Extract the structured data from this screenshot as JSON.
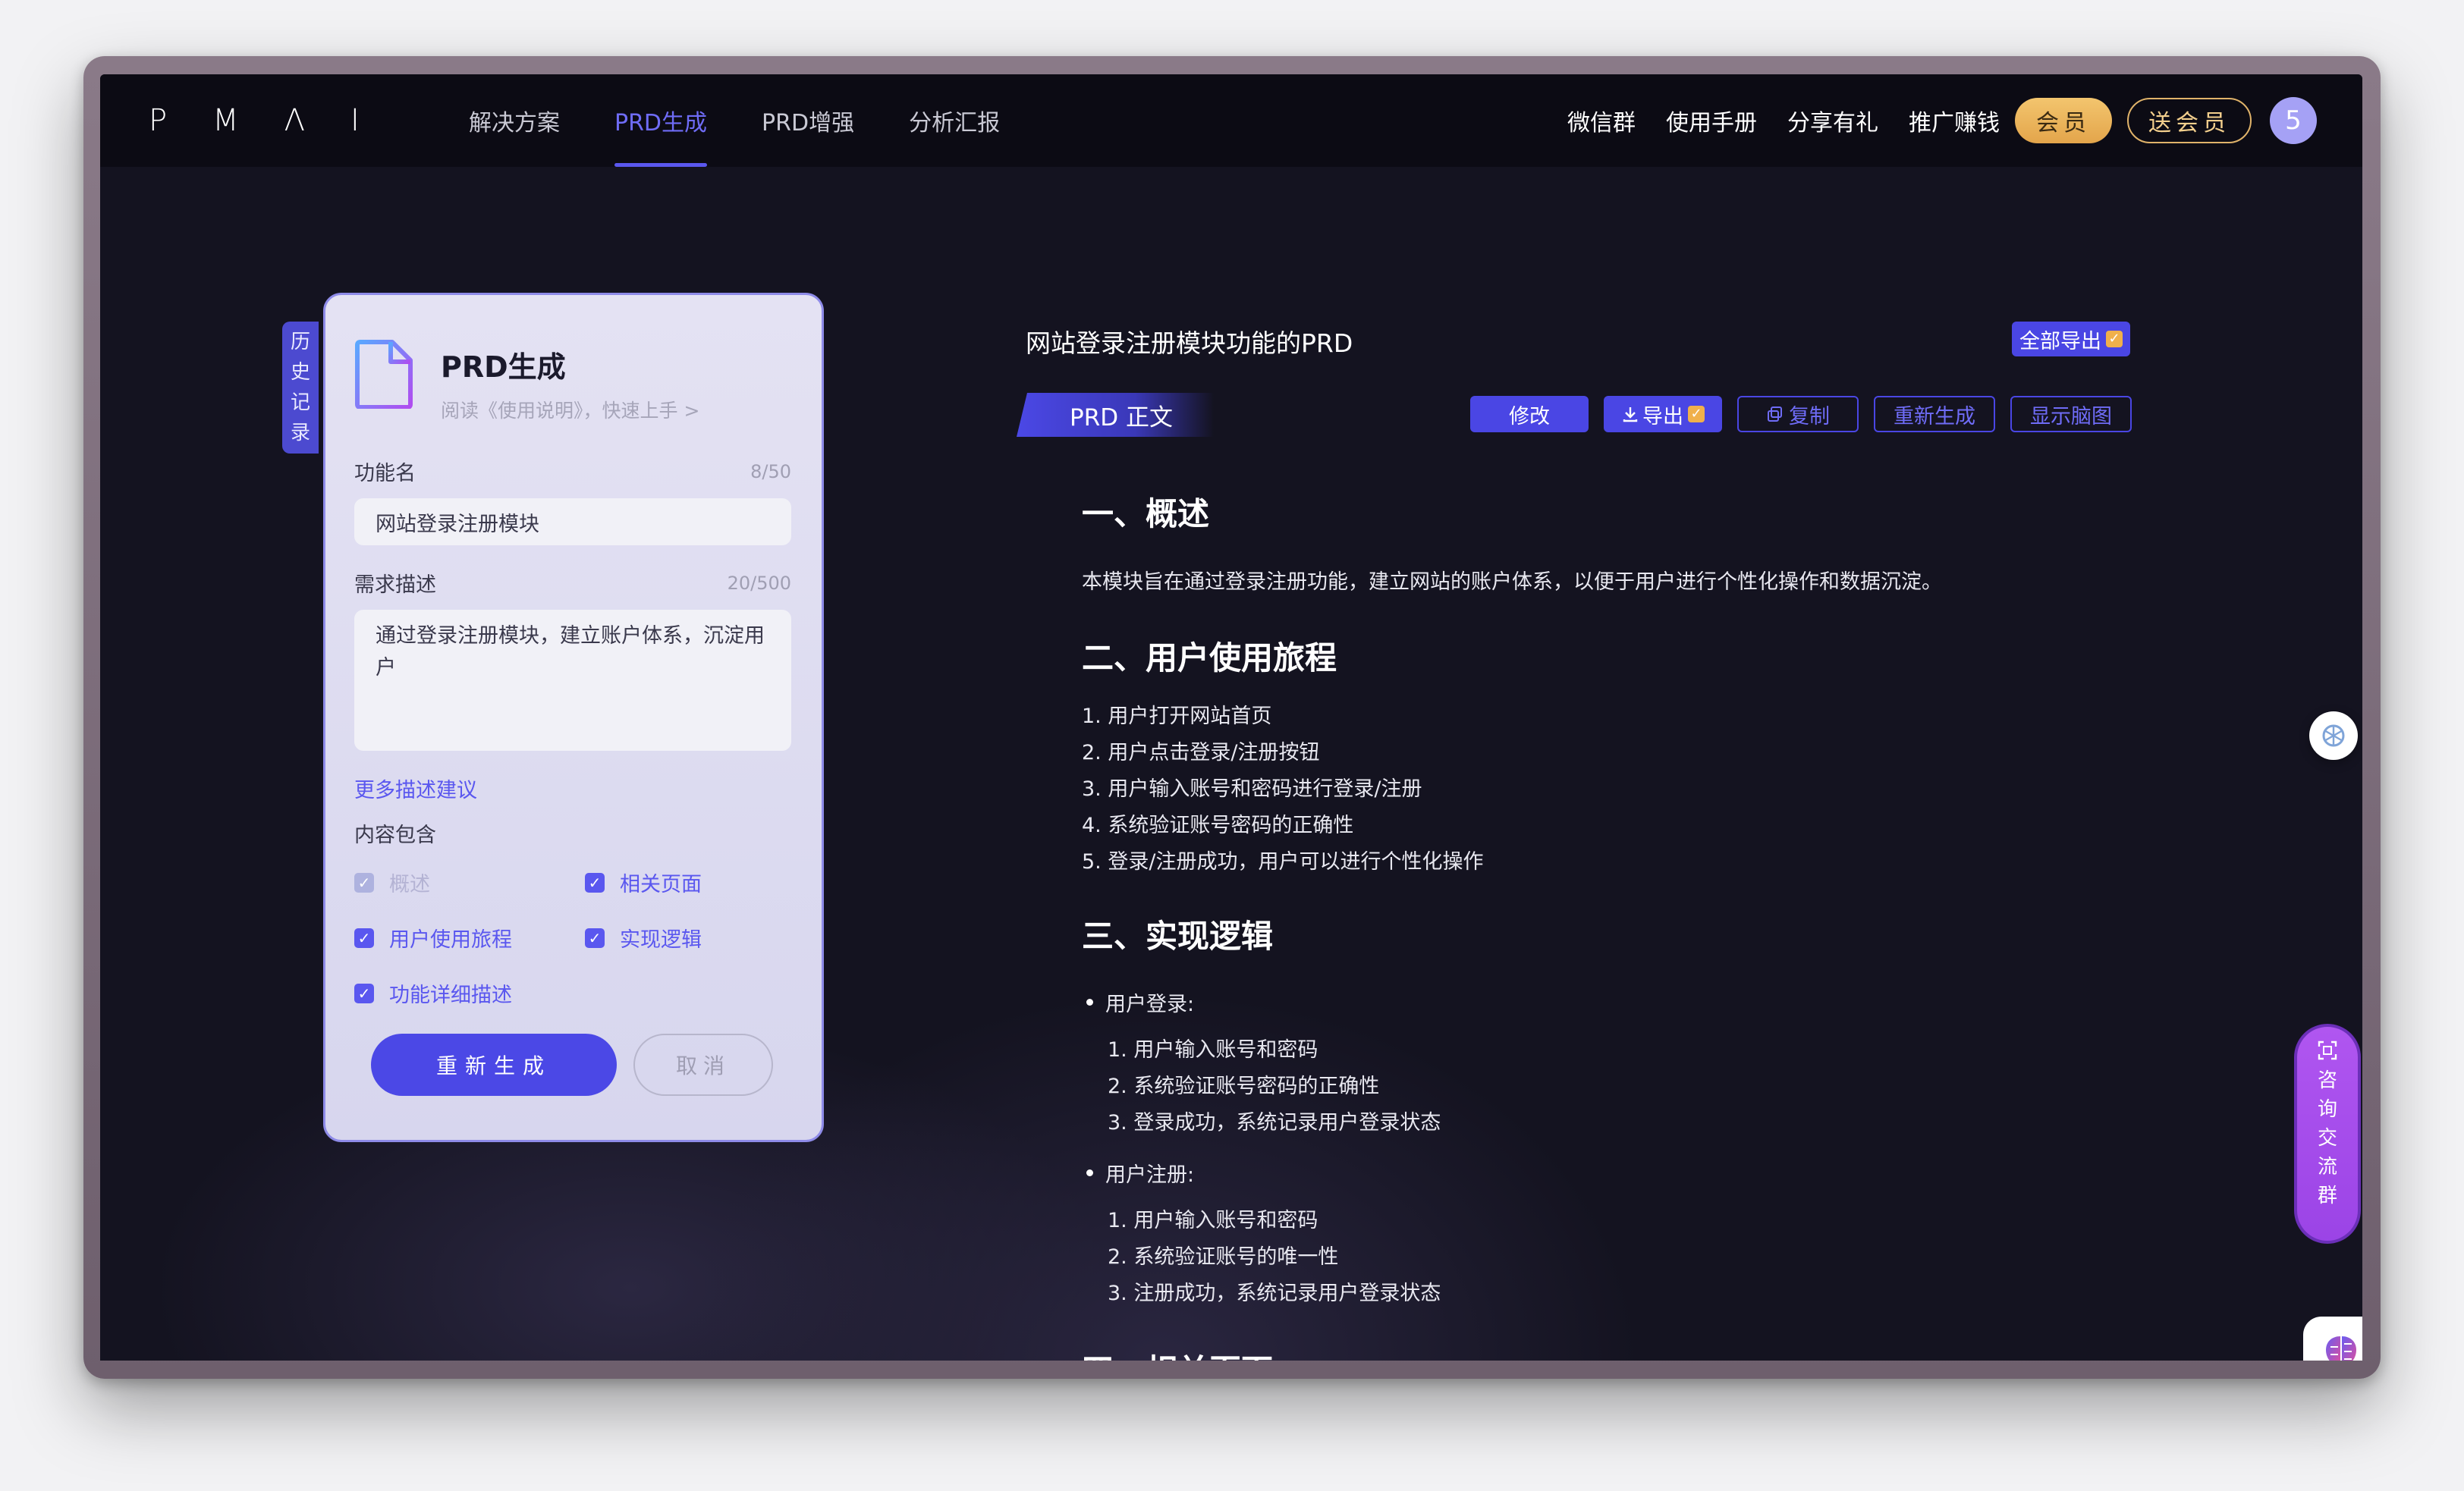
{
  "logo": [
    "P",
    "M",
    "Λ",
    "I"
  ],
  "nav": {
    "items": [
      {
        "label": "解决方案",
        "active": false
      },
      {
        "label": "PRD生成",
        "active": true
      },
      {
        "label": "PRD增强",
        "active": false
      },
      {
        "label": "分析汇报",
        "active": false
      }
    ]
  },
  "header_right": {
    "wechat": "微信群",
    "manual": "使用手册",
    "share": "分享有礼",
    "promote": "推广赚钱",
    "member": "会员",
    "gift_member": "送会员",
    "avatar": "5"
  },
  "history_tab": [
    "历",
    "史",
    "记",
    "录"
  ],
  "form": {
    "title": "PRD生成",
    "subtitle": "阅读《使用说明》，快速上手 >",
    "name_label": "功能名",
    "name_counter": "8/50",
    "name_value": "网站登录注册模块",
    "desc_label": "需求描述",
    "desc_counter": "20/500",
    "desc_value": "通过登录注册模块，建立账户体系，沉淀用户",
    "more_link": "更多描述建议",
    "include_label": "内容包含",
    "checks": [
      {
        "label": "概述",
        "checked": true,
        "disabled": true
      },
      {
        "label": "相关页面",
        "checked": true,
        "disabled": false
      },
      {
        "label": "用户使用旅程",
        "checked": true,
        "disabled": false
      },
      {
        "label": "实现逻辑",
        "checked": true,
        "disabled": false
      },
      {
        "label": "功能详细描述",
        "checked": true,
        "disabled": false
      }
    ],
    "regenerate": "重新生成",
    "cancel": "取消"
  },
  "doc": {
    "title": "网站登录注册模块功能的PRD",
    "export_all": "全部导出",
    "tab": "PRD 正文",
    "actions": {
      "edit": "修改",
      "export": "导出",
      "copy": "复制",
      "regen": "重新生成",
      "mindmap": "显示脑图"
    },
    "s1_title": "一、概述",
    "s1_text": "本模块旨在通过登录注册功能，建立网站的账户体系，以便于用户进行个性化操作和数据沉淀。",
    "s2_title": "二、用户使用旅程",
    "s2_items": [
      "1. 用户打开网站首页",
      "2. 用户点击登录/注册按钮",
      "3. 用户输入账号和密码进行登录/注册",
      "4. 系统验证账号密码的正确性",
      "5. 登录/注册成功，用户可以进行个性化操作"
    ],
    "s3_title": "三、实现逻辑",
    "login_label": "用户登录:",
    "login_items": [
      "1. 用户输入账号和密码",
      "2. 系统验证账号密码的正确性",
      "3. 登录成功，系统记录用户登录状态"
    ],
    "register_label": "用户注册:",
    "register_items": [
      "1. 用户输入账号和密码",
      "2. 系统验证账号的唯一性",
      "3. 注册成功，系统记录用户登录状态"
    ],
    "s4_title": "四、相关页面"
  },
  "consult": [
    "咨",
    "询",
    "交",
    "流",
    "群"
  ],
  "colors": {
    "accent": "#4b48e6",
    "nav_active": "#6f6cf7",
    "bg": "#141320",
    "gold": "#e3a54b"
  }
}
